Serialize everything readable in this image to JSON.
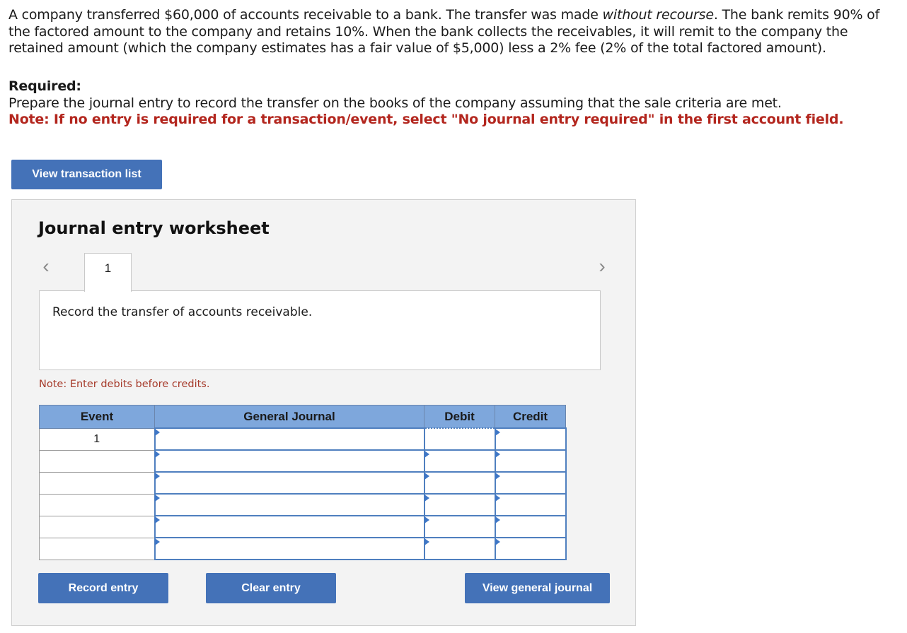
{
  "problem": {
    "part1": "A company transferred $60,000 of accounts receivable to a bank. The transfer was made ",
    "emphasis": "without recourse",
    "part2": ". The bank remits 90% of the factored amount to the company and retains 10%. When the bank collects the receivables, it will remit to the company the retained amount (which the company estimates has a fair value of $5,000) less a 2% fee (2% of the total factored amount)."
  },
  "required": {
    "title": "Required:",
    "text": "Prepare the journal entry to record the transfer on the books of the company assuming that the sale criteria are met.",
    "note": "Note: If no entry is required for a transaction/event, select \"No journal entry required\" in the first account field."
  },
  "buttons": {
    "view_transaction_list": "View transaction list",
    "record_entry": "Record entry",
    "clear_entry": "Clear entry",
    "view_general_journal": "View general journal"
  },
  "worksheet": {
    "title": "Journal entry worksheet",
    "prev_glyph": "‹",
    "next_glyph": "›",
    "active_tab": "1",
    "description": "Record the transfer of accounts receivable.",
    "note": "Note: Enter debits before credits.",
    "table": {
      "headers": {
        "event": "Event",
        "general_journal": "General Journal",
        "debit": "Debit",
        "credit": "Credit"
      },
      "rows": [
        {
          "event": "1",
          "account": "",
          "debit": "",
          "credit": ""
        },
        {
          "event": "",
          "account": "",
          "debit": "",
          "credit": ""
        },
        {
          "event": "",
          "account": "",
          "debit": "",
          "credit": ""
        },
        {
          "event": "",
          "account": "",
          "debit": "",
          "credit": ""
        },
        {
          "event": "",
          "account": "",
          "debit": "",
          "credit": ""
        },
        {
          "event": "",
          "account": "",
          "debit": "",
          "credit": ""
        }
      ]
    }
  },
  "colors": {
    "button_blue": "#4472b8",
    "header_blue": "#7ea7dc",
    "note_red": "#b3261e",
    "worksheet_bg": "#f3f3f3"
  }
}
